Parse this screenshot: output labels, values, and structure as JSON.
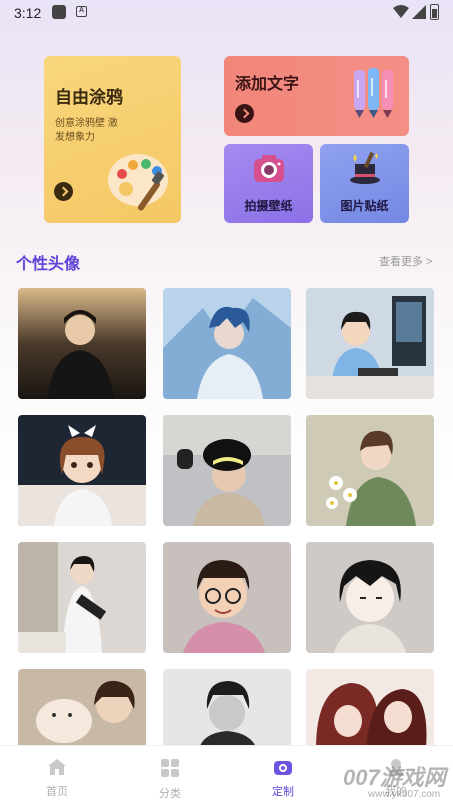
{
  "status_bar": {
    "time": "3:12"
  },
  "features": {
    "graffiti": {
      "title": "自由涂鸦",
      "subtitle": "创意涂鸦壁 激发想象力"
    },
    "add_text": {
      "title": "添加文字"
    },
    "wallpaper": {
      "label": "拍摄壁纸"
    },
    "sticker": {
      "label": "图片贴纸"
    }
  },
  "section": {
    "title": "个性头像",
    "more": "查看更多 >"
  },
  "avatars": [
    {
      "subject": "young man outdoors at dusk"
    },
    {
      "subject": "anime boy with blue hair"
    },
    {
      "subject": "anime boy at computer desk"
    },
    {
      "subject": "cartoon girl with bow"
    },
    {
      "subject": "boy in fur hat selfie"
    },
    {
      "subject": "anime boy with flowers"
    },
    {
      "subject": "girl with melodica"
    },
    {
      "subject": "cartoon boy with glasses"
    },
    {
      "subject": "anime boy black hair"
    },
    {
      "subject": "girl with cat"
    },
    {
      "subject": "black and white portrait"
    },
    {
      "subject": "anime couple red hair"
    }
  ],
  "bottom_nav": {
    "items": [
      {
        "label": "首页",
        "icon": "home-icon"
      },
      {
        "label": "分类",
        "icon": "grid-icon"
      },
      {
        "label": "定制",
        "icon": "camera-icon",
        "active": true
      },
      {
        "label": "我的",
        "icon": "user-icon"
      }
    ]
  },
  "watermark": {
    "main": "007游戏网",
    "sub": "www.yx007.com"
  },
  "colors": {
    "accent": "#5f43d6",
    "graffiti_card": "#f6cd6f",
    "text_card": "#f48a80",
    "wallpaper_card": "#9a80ee",
    "sticker_card": "#8296ea"
  }
}
